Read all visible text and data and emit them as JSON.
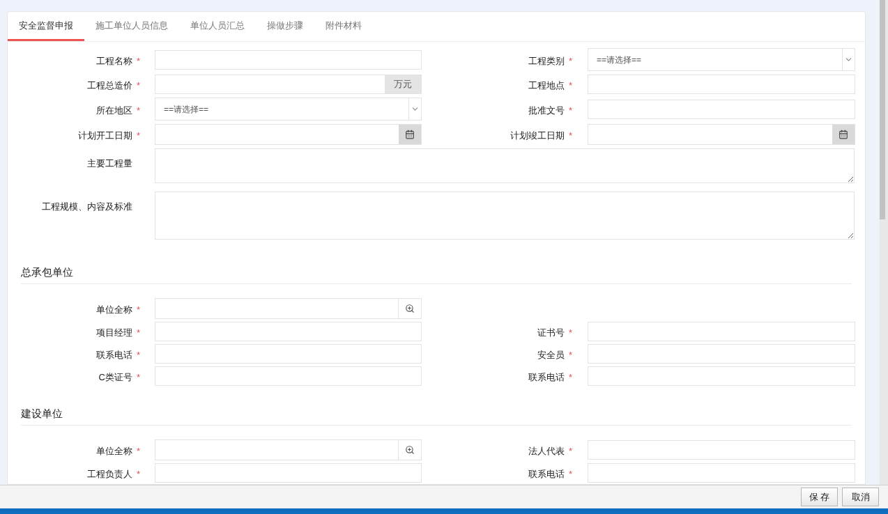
{
  "tabs": [
    {
      "label": "安全监督申报",
      "selected": true
    },
    {
      "label": "施工单位人员信息",
      "selected": false
    },
    {
      "label": "单位人员汇总",
      "selected": false
    },
    {
      "label": "操做步骤",
      "selected": false
    },
    {
      "label": "附件材料",
      "selected": false
    }
  ],
  "basic_rows": [
    [
      {
        "label": "工程名称",
        "marker": "*",
        "kind": "text"
      },
      {
        "label": "工程类别",
        "marker": "*",
        "kind": "select",
        "value": "==请选择=="
      }
    ],
    [
      {
        "label": "工程总造价",
        "marker": "*",
        "kind": "addon",
        "addon": "万元"
      },
      {
        "label": "工程地点",
        "marker": "*",
        "kind": "text"
      }
    ],
    [
      {
        "label": "所在地区",
        "marker": "*",
        "kind": "select",
        "value": "==请选择=="
      },
      {
        "label": "批准文号",
        "marker": "*",
        "kind": "text"
      }
    ],
    [
      {
        "label": "计划开工日期",
        "marker": "*",
        "kind": "date"
      },
      {
        "label": "计划竣工日期",
        "marker": "*",
        "kind": "date"
      }
    ],
    [
      {
        "label": "主要工程量",
        "kind": "textarea"
      }
    ],
    [
      {
        "label": "工程规模、内容及标准",
        "kind": "large_textarea"
      }
    ]
  ],
  "sections": [
    {
      "title": "总承包单位",
      "rows": [
        [
          {
            "label": "单位全称",
            "marker": "*",
            "kind": "search"
          }
        ],
        [
          {
            "label": "项目经理",
            "marker": "*",
            "kind": "text"
          },
          {
            "label": "证书号",
            "marker": "*",
            "kind": "text"
          }
        ],
        [
          {
            "label": "联系电话",
            "marker": "*",
            "kind": "text"
          },
          {
            "label": "安全员",
            "marker": "*",
            "kind": "text"
          }
        ],
        [
          {
            "label": "C类证号",
            "marker": "*",
            "kind": "text"
          },
          {
            "label": "联系电话",
            "marker": "*",
            "kind": "text"
          }
        ]
      ]
    },
    {
      "title": "建设单位",
      "rows": [
        [
          {
            "label": "单位全称",
            "marker": "*",
            "kind": "search"
          },
          {
            "label": "法人代表",
            "marker": "*",
            "kind": "text"
          }
        ],
        [
          {
            "label": "工程负责人",
            "marker": "*",
            "kind": "text"
          },
          {
            "label": "联系电话",
            "marker": "*",
            "kind": "text"
          }
        ]
      ]
    }
  ],
  "buttons": [
    "保 存",
    "取消"
  ]
}
